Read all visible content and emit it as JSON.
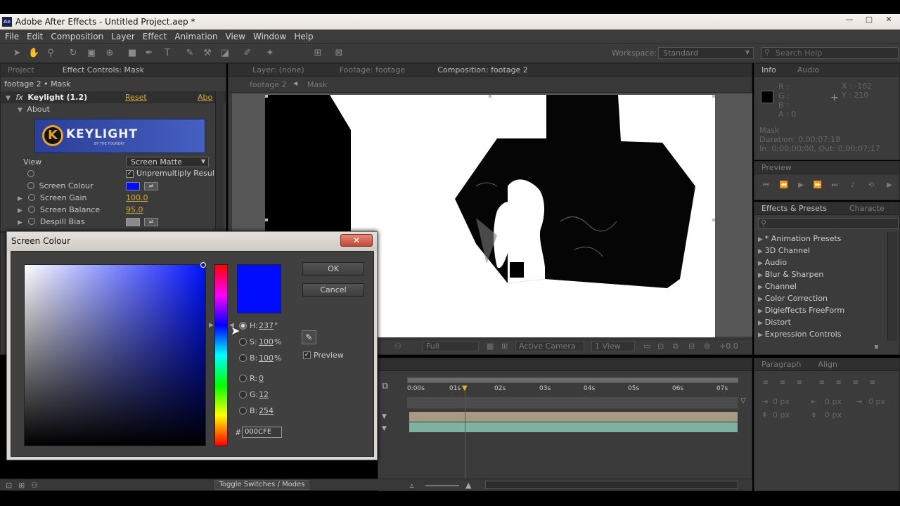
{
  "window": {
    "title": "Adobe After Effects - Untitled Project.aep *",
    "app_badge": "Ae",
    "minimize": "—",
    "maximize": "▢",
    "close": "✕"
  },
  "menu": [
    "File",
    "Edit",
    "Composition",
    "Layer",
    "Effect",
    "Animation",
    "View",
    "Window",
    "Help"
  ],
  "toolbar": {
    "workspace_label": "Workspace:",
    "workspace_value": "Standard",
    "search_placeholder": "Search Help"
  },
  "project_panel": {
    "tab_project": "Project",
    "tab_effect_controls": "Effect Controls: Mask",
    "layer_path": "footage 2 • Mask"
  },
  "effect": {
    "fx_badge": "fx",
    "name": "Keylight (1.2)",
    "reset": "Reset",
    "about_link": "Abo",
    "about_group": "About",
    "logo_text": "KEYLIGHT",
    "logo_sub": "BY THE FOUNDRY",
    "view_label": "View",
    "view_value": "Screen Matte",
    "unpremultiply_label": "Unpremultiply Resul",
    "screen_colour_label": "Screen Colour",
    "screen_gain_label": "Screen Gain",
    "screen_gain_value": "100.0",
    "screen_balance_label": "Screen Balance",
    "screen_balance_value": "95.0",
    "despill_bias_label": "Despill Bias",
    "screen_colour_hex": "#000CFE"
  },
  "viewer_tabs": {
    "layer": "Layer: (none)",
    "footage": "Footage: footage",
    "composition": "Composition: footage 2",
    "crumb_1": "footage 2",
    "crumb_2": "Mask"
  },
  "viewer_footer": {
    "resolution": "Full",
    "camera": "Active Camera",
    "views": "1 View",
    "offset": "+0.0"
  },
  "info_panel": {
    "tab_info": "Info",
    "tab_audio": "Audio",
    "r": "R :",
    "g": "G :",
    "b": "B :",
    "a": "A : 0",
    "x": "X : -102",
    "y": "Y : 210",
    "layer_name": "Mask",
    "duration": "Duration: 0;00;07;18",
    "in_out": "In: 0;00;00;00, Out: 0;00;07;17"
  },
  "preview_panel": {
    "tab": "Preview"
  },
  "effects_presets": {
    "tab": "Effects & Presets",
    "tab2": "Characte",
    "items": [
      "* Animation Presets",
      "3D Channel",
      "Audio",
      "Blur & Sharpen",
      "Channel",
      "Color Correction",
      "Digieffects FreeForm",
      "Distort",
      "Expression Controls"
    ]
  },
  "paragraph_panel": {
    "tab": "Paragraph",
    "tab2": "Align",
    "indent_1": "0 px",
    "indent_2": "0 px",
    "indent_3": "0 px",
    "space_1": "0 px",
    "space_2": "0 px"
  },
  "timeline": {
    "ruler": [
      "0:00s",
      "01s",
      "02s",
      "03s",
      "04s",
      "05s",
      "06s",
      "07s"
    ],
    "toggle_label": "Toggle Switches / Modes"
  },
  "dialog": {
    "title": "Screen Colour",
    "close": "✕",
    "ok": "OK",
    "cancel": "Cancel",
    "h_label": "H:",
    "h_value": "237",
    "h_unit": "°",
    "s_label": "S:",
    "s_value": "100",
    "s_unit": "%",
    "b_label": "B:",
    "b_value": "100",
    "b_unit": "%",
    "r_label": "R:",
    "r_value": "0",
    "g_label": "G:",
    "g_value": "12",
    "b2_label": "B:",
    "b2_value": "254",
    "hex_label": "#",
    "hex_value": "000CFE",
    "preview_label": "Preview",
    "current_colour": "#000CFE",
    "field_hue_colour": "#0012FF"
  }
}
